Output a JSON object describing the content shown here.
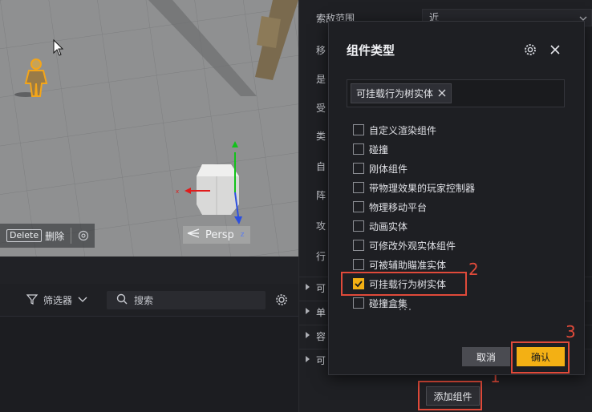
{
  "viewport": {
    "delete_key": "Delete",
    "delete_label": "删除",
    "persp_label": "Persp",
    "axis_x": "x",
    "axis_z": "z"
  },
  "bottom_panel": {
    "filter_label": "筛选器",
    "search_placeholder": "搜索"
  },
  "properties": {
    "rows": [
      {
        "label": "索敌范围",
        "value": "近"
      },
      {
        "label": "移",
        "value": ""
      },
      {
        "label": "是",
        "value": ""
      },
      {
        "label": "受",
        "value": ""
      },
      {
        "label": "类",
        "value": ""
      },
      {
        "label": "自",
        "value": ""
      },
      {
        "label": "阵",
        "value": ""
      },
      {
        "label": "攻",
        "value": ""
      },
      {
        "label": "行",
        "value": ""
      }
    ],
    "sections": [
      "可",
      "单",
      "容",
      "可"
    ],
    "add_component_label": "添加组件"
  },
  "dialog": {
    "title": "组件类型",
    "selected_tag": "可挂载行为树实体",
    "options": [
      {
        "label": "自定义渲染组件",
        "checked": false
      },
      {
        "label": "碰撞",
        "checked": false
      },
      {
        "label": "刚体组件",
        "checked": false
      },
      {
        "label": "带物理效果的玩家控制器",
        "checked": false
      },
      {
        "label": "物理移动平台",
        "checked": false
      },
      {
        "label": "动画实体",
        "checked": false
      },
      {
        "label": "可修改外观实体组件",
        "checked": false
      },
      {
        "label": "可被辅助瞄准实体",
        "checked": false
      },
      {
        "label": "可挂载行为树实体",
        "checked": true
      },
      {
        "label": "碰撞盒集",
        "checked": false
      }
    ],
    "cancel_label": "取消",
    "confirm_label": "确认"
  },
  "annotations": {
    "n1": "1",
    "n2": "2",
    "n3": "3"
  },
  "colors": {
    "accent": "#f3b014",
    "highlight": "#e04a3a"
  }
}
